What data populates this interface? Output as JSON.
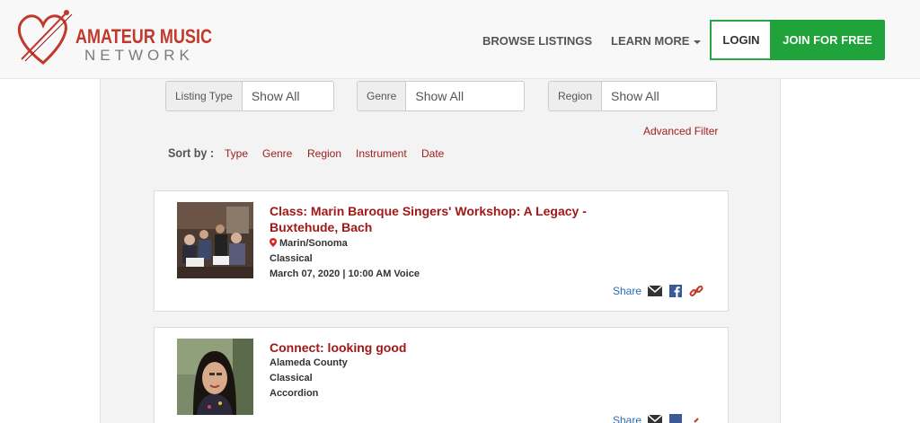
{
  "header": {
    "logo_line1": "AMATEUR MUSIC",
    "logo_line2": "NETWORK",
    "nav": {
      "browse": "BROWSE LISTINGS",
      "learn": "LEARN MORE"
    },
    "login": "LOGIN",
    "join": "JOIN FOR FREE"
  },
  "filters": [
    {
      "label": "Listing Type",
      "value": "Show All"
    },
    {
      "label": "Genre",
      "value": "Show All"
    },
    {
      "label": "Region",
      "value": "Show All"
    }
  ],
  "advanced_filter": "Advanced Filter",
  "sort": {
    "label": "Sort by :",
    "options": [
      "Type",
      "Genre",
      "Region",
      "Instrument",
      "Date"
    ]
  },
  "listings": [
    {
      "title": "Class: Marin Baroque Singers' Workshop: A Legacy - Buxtehude, Bach",
      "location": "Marin/Sonoma",
      "genre": "Classical",
      "detail": "March 07, 2020 | 10:00 AM Voice",
      "share": "Share"
    },
    {
      "title": "Connect: looking good",
      "location": "Alameda County",
      "genre": "Classical",
      "detail": "Accordion",
      "share": "Share"
    }
  ],
  "colors": {
    "brand_red": "#a01818",
    "join_green": "#1fa33a",
    "link_blue": "#2a6db5"
  }
}
